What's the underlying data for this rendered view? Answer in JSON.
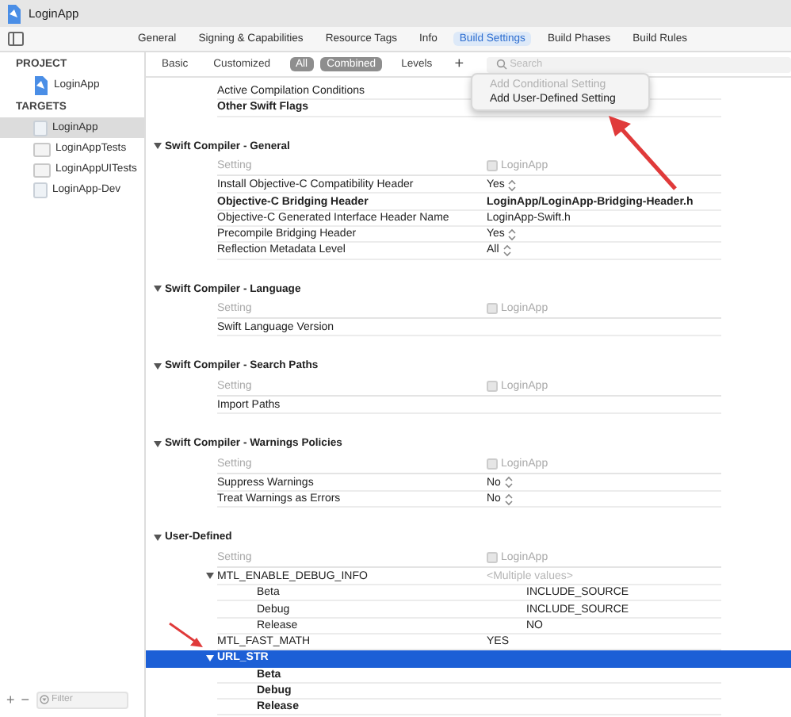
{
  "window": {
    "title": "LoginApp"
  },
  "tabs": [
    {
      "label": "General",
      "selected": false
    },
    {
      "label": "Signing & Capabilities",
      "selected": false
    },
    {
      "label": "Resource Tags",
      "selected": false
    },
    {
      "label": "Info",
      "selected": false
    },
    {
      "label": "Build Settings",
      "selected": true
    },
    {
      "label": "Build Phases",
      "selected": false
    },
    {
      "label": "Build Rules",
      "selected": false
    }
  ],
  "filter_bar": {
    "scopes": [
      {
        "label": "Basic",
        "selected": false
      },
      {
        "label": "Customized",
        "selected": false
      },
      {
        "label": "All",
        "selected": true
      }
    ],
    "views": [
      {
        "label": "Combined",
        "selected": true
      },
      {
        "label": "Levels",
        "selected": false
      }
    ],
    "add_button": "+",
    "search": {
      "placeholder": "Search"
    }
  },
  "popup_menu": {
    "items": [
      {
        "label": "Add Conditional Setting",
        "disabled": true
      },
      {
        "label": "Add User-Defined Setting",
        "disabled": false
      }
    ]
  },
  "sidebar": {
    "groups": [
      {
        "title": "PROJECT",
        "items": [
          {
            "label": "LoginApp",
            "kind": "project",
            "selected": false
          }
        ]
      },
      {
        "title": "TARGETS",
        "items": [
          {
            "label": "LoginApp",
            "kind": "app",
            "selected": true
          },
          {
            "label": "LoginAppTests",
            "kind": "test",
            "selected": false
          },
          {
            "label": "LoginAppUITests",
            "kind": "test",
            "selected": false
          },
          {
            "label": "LoginApp-Dev",
            "kind": "app",
            "selected": false
          }
        ]
      }
    ],
    "footer": {
      "add": "+",
      "remove": "−",
      "filter_placeholder": "Filter"
    }
  },
  "sections": [
    {
      "rows": [
        {
          "name": "Active Compilation Conditions",
          "customized": false,
          "selected": false
        },
        {
          "name": "Other Swift Flags",
          "customized": true,
          "selected": false
        }
      ]
    },
    {
      "title": "Swift Compiler - General",
      "expanded": true,
      "column_header": {
        "setting": "Setting",
        "target": "LoginApp"
      },
      "rows": [
        {
          "name": "Install Objective-C Compatibility Header",
          "value": "Yes",
          "kind": "popup",
          "customized": false,
          "selected": false
        },
        {
          "name": "Objective-C Bridging Header",
          "value": "LoginApp/LoginApp-Bridging-Header.h",
          "kind": "text",
          "customized": true,
          "selected": false
        },
        {
          "name": "Objective-C Generated Interface Header Name",
          "value": "LoginApp-Swift.h",
          "kind": "text",
          "customized": false,
          "selected": false
        },
        {
          "name": "Precompile Bridging Header",
          "value": "Yes",
          "kind": "popup",
          "customized": false,
          "selected": false
        },
        {
          "name": "Reflection Metadata Level",
          "value": "All",
          "kind": "popup",
          "customized": false,
          "selected": false
        }
      ]
    },
    {
      "title": "Swift Compiler - Language",
      "expanded": true,
      "column_header": {
        "setting": "Setting",
        "target": "LoginApp"
      },
      "rows": [
        {
          "name": "Swift Language Version",
          "customized": false,
          "selected": false
        }
      ]
    },
    {
      "title": "Swift Compiler - Search Paths",
      "expanded": true,
      "column_header": {
        "setting": "Setting",
        "target": "LoginApp"
      },
      "rows": [
        {
          "name": "Import Paths",
          "customized": false,
          "selected": false
        }
      ]
    },
    {
      "title": "Swift Compiler - Warnings Policies",
      "expanded": true,
      "column_header": {
        "setting": "Setting",
        "target": "LoginApp"
      },
      "rows": [
        {
          "name": "Suppress Warnings",
          "value": "No",
          "kind": "popup",
          "customized": false,
          "selected": false
        },
        {
          "name": "Treat Warnings as Errors",
          "value": "No",
          "kind": "popup",
          "customized": false,
          "selected": false
        }
      ]
    },
    {
      "title": "User-Defined",
      "expanded": true,
      "column_header": {
        "setting": "Setting",
        "target": "LoginApp"
      },
      "rows": [
        {
          "name": "MTL_ENABLE_DEBUG_INFO",
          "value": "<Multiple values>",
          "kind": "multiple",
          "customized": false,
          "selected": false,
          "expanded": true,
          "children": [
            {
              "name": "Beta",
              "value": "INCLUDE_SOURCE",
              "kind": "text",
              "customized": false,
              "selected": false
            },
            {
              "name": "Debug",
              "value": "INCLUDE_SOURCE",
              "kind": "text",
              "customized": false,
              "selected": false
            },
            {
              "name": "Release",
              "value": "NO",
              "kind": "text",
              "customized": false,
              "selected": false
            }
          ]
        },
        {
          "name": "MTL_FAST_MATH",
          "value": "YES",
          "kind": "text",
          "customized": false,
          "selected": false
        },
        {
          "name": "URL_STR",
          "customized": true,
          "selected": true,
          "expanded": true,
          "children": [
            {
              "name": "Beta",
              "customized": true,
              "selected": false
            },
            {
              "name": "Debug",
              "customized": true,
              "selected": false
            },
            {
              "name": "Release",
              "customized": true,
              "selected": false
            }
          ]
        }
      ]
    }
  ]
}
